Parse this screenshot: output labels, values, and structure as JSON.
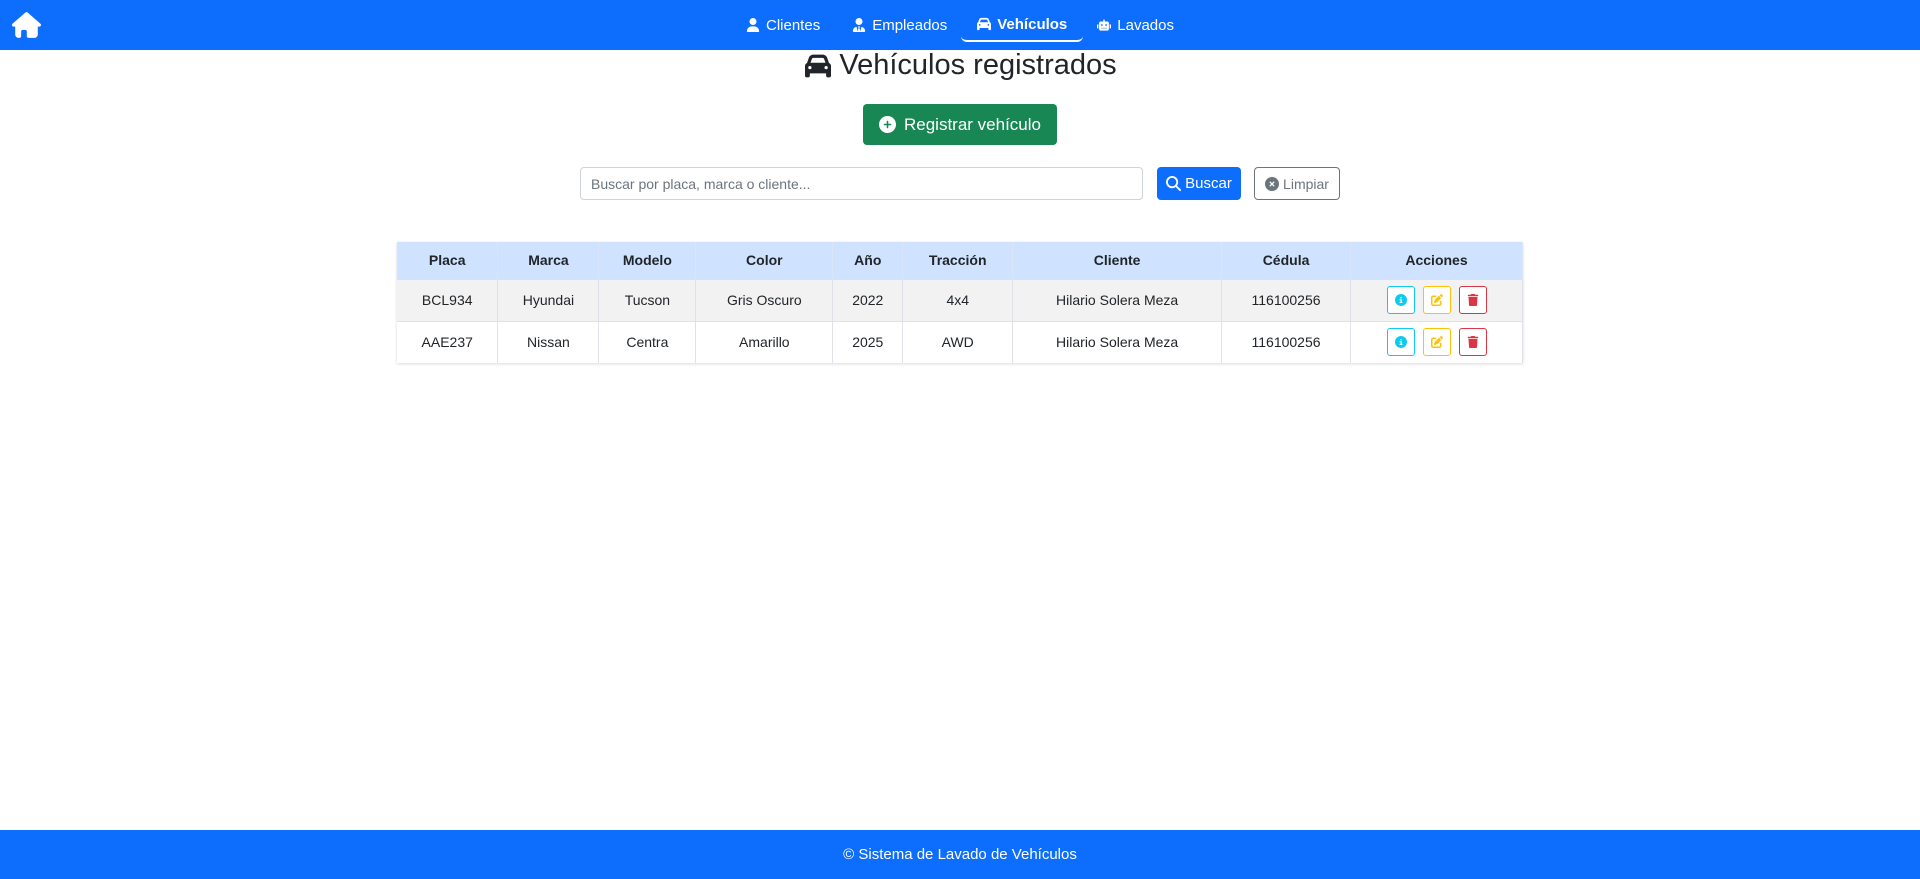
{
  "nav": {
    "home_icon": "house-icon",
    "items": [
      {
        "label": "Clientes",
        "icon": "user-icon",
        "active": false
      },
      {
        "label": "Empleados",
        "icon": "user-tie-icon",
        "active": false
      },
      {
        "label": "Vehículos",
        "icon": "car-icon",
        "active": true
      },
      {
        "label": "Lavados",
        "icon": "robot-icon",
        "active": false
      }
    ]
  },
  "page": {
    "title": "Vehículos registrados",
    "title_icon": "car-icon",
    "register_label": "Registrar vehículo"
  },
  "search": {
    "placeholder": "Buscar por placa, marca o cliente...",
    "value": "",
    "search_label": "Buscar",
    "clear_label": "Limpiar"
  },
  "table": {
    "headers": [
      "Placa",
      "Marca",
      "Modelo",
      "Color",
      "Año",
      "Tracción",
      "Cliente",
      "Cédula",
      "Acciones"
    ],
    "rows": [
      [
        "BCL934",
        "Hyundai",
        "Tucson",
        "Gris Oscuro",
        "2022",
        "4x4",
        "Hilario Solera Meza",
        "116100256"
      ],
      [
        "AAE237",
        "Nissan",
        "Centra",
        "Amarillo",
        "2025",
        "AWD",
        "Hilario Solera Meza",
        "116100256"
      ]
    ]
  },
  "footer": {
    "text": "© Sistema de Lavado de Vehículos"
  },
  "colors": {
    "primary": "#0d6efd",
    "success": "#198754",
    "info": "#0dcaf0",
    "warning": "#ffc107",
    "danger": "#dc3545",
    "header_bg": "#cfe2ff"
  }
}
